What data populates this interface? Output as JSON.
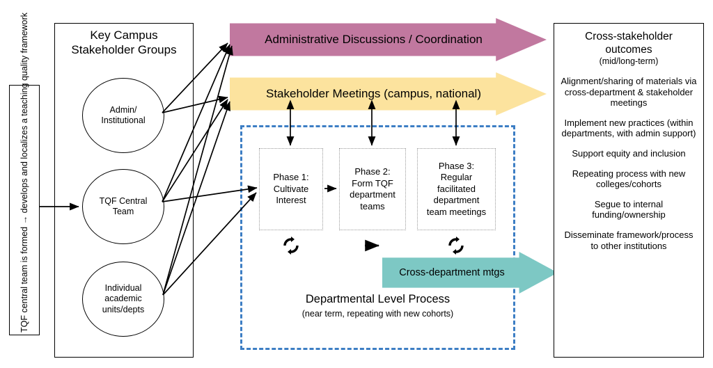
{
  "left_panel": {
    "vertical_label": "TQF central team is formed → develops and localizes a teaching quality framework"
  },
  "stakeholders": {
    "title": "Key Campus\nStakeholder Groups",
    "title_line1": "Key Campus",
    "title_line2": "Stakeholder Groups",
    "circles": [
      {
        "id": "admin",
        "label": "Admin/\nInstitutional"
      },
      {
        "id": "tqf-central-team",
        "label": "TQF Central\nTeam"
      },
      {
        "id": "academic-units",
        "label": "Individual\nacademic\nunits/depts"
      }
    ]
  },
  "banners": [
    {
      "id": "administrative-discussions",
      "label": "Administrative Discussions / Coordination",
      "color": "#c1789f"
    },
    {
      "id": "stakeholder-meetings",
      "label": "Stakeholder Meetings (campus, national)",
      "color": "#fce39e"
    },
    {
      "id": "cross-department-meetings",
      "label": "Cross-department mtgs",
      "color": "#7dc8c4"
    }
  ],
  "departmental_process": {
    "title": "Departmental Level Process",
    "subtitle": "(near term, repeating with new cohorts)",
    "border_color": "#3d7ec4",
    "phases": [
      {
        "id": "phase-1",
        "label": "Phase 1:\nCultivate\nInterest",
        "marker": "cycle"
      },
      {
        "id": "phase-2",
        "label": "Phase 2:\nForm TQF\ndepartment\nteams",
        "marker": "arrow"
      },
      {
        "id": "phase-3",
        "label": "Phase 3:\nRegular\nfacilitated\ndepartment\nteam meetings",
        "marker": "cycle"
      }
    ]
  },
  "outcomes": {
    "title": "Cross-stakeholder\noutcomes",
    "title_line1": "Cross-stakeholder",
    "title_line2": "outcomes",
    "subtitle": "(mid/long-term)",
    "items": [
      "Alignment/sharing of materials via cross-department & stakeholder meetings",
      "Implement new practices (within departments, with admin support)",
      "Support equity and inclusion",
      "Repeating process with new colleges/cohorts",
      "Segue to internal funding/ownership",
      "Disseminate framework/process to other institutions"
    ]
  }
}
